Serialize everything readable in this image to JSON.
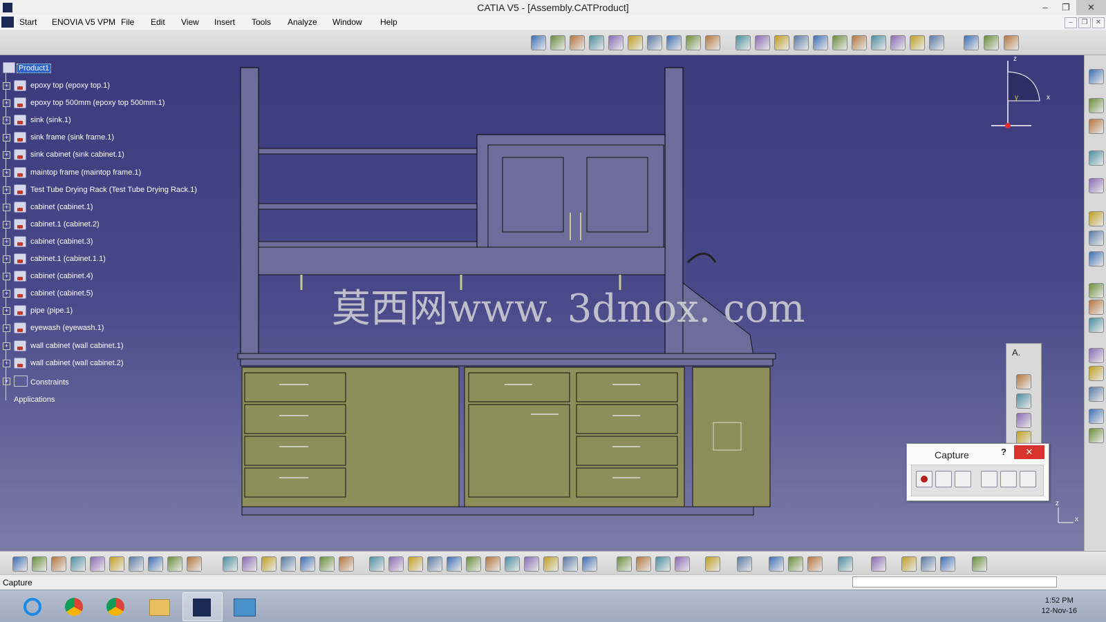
{
  "window": {
    "title": "CATIA V5 - [Assembly.CATProduct]",
    "min": "–",
    "restore": "❐",
    "close": "✕"
  },
  "menu": {
    "items": [
      "Start",
      "ENOVIA V5 VPM",
      "File",
      "Edit",
      "View",
      "Insert",
      "Tools",
      "Analyze",
      "Window",
      "Help"
    ],
    "mdi": [
      "–",
      "❐",
      "✕"
    ]
  },
  "tree": {
    "root": "Product1",
    "items": [
      "epoxy top (epoxy top.1)",
      "epoxy top 500mm (epoxy top 500mm.1)",
      "sink (sink.1)",
      "sink frame (sink frame.1)",
      "sink cabinet (sink cabinet.1)",
      "maintop frame (maintop frame.1)",
      "Test Tube Drying Rack (Test Tube Drying Rack.1)",
      "cabinet (cabinet.1)",
      "cabinet.1 (cabinet.2)",
      "cabinet (cabinet.3)",
      "cabinet.1 (cabinet.1.1)",
      "cabinet (cabinet.4)",
      "cabinet (cabinet.5)",
      "pipe (pipe.1)",
      "eyewash (eyewash.1)",
      "wall cabinet (wall cabinet.1)",
      "wall cabinet (wall cabinet.2)"
    ],
    "constraints": "Constraints",
    "applications": "Applications",
    "expander": "+"
  },
  "viewport": {
    "watermark": "莫西网www. 3dmox. com",
    "compass": {
      "z": "z",
      "x": "x",
      "y": "y"
    },
    "axis_small": {
      "z": "z",
      "x": "x"
    }
  },
  "annotation_toolbar": {
    "label": "A."
  },
  "capture": {
    "title": "Capture",
    "help": "?",
    "close": "✕"
  },
  "status": {
    "text": "Capture",
    "command": ""
  },
  "taskbar": {
    "time": "1:52 PM",
    "date": "12-Nov-16"
  },
  "colors": {
    "viewport_top": "#3a3a7c",
    "viewport_bottom": "#7c7ca8",
    "cabinet": "#8e8e5a",
    "frame": "#6d6d9c"
  }
}
